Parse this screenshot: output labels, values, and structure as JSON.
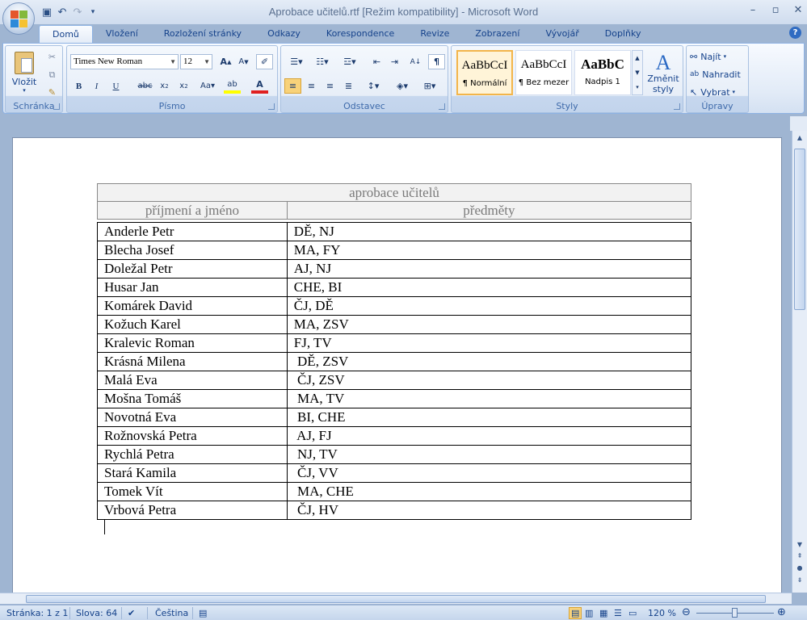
{
  "window": {
    "title": "Aprobace učitelů.rtf [Režim kompatibility] - Microsoft Word"
  },
  "ribbon": {
    "tabs": [
      "Domů",
      "Vložení",
      "Rozložení stránky",
      "Odkazy",
      "Korespondence",
      "Revize",
      "Zobrazení",
      "Vývojář",
      "Doplňky"
    ],
    "active_tab": "Domů",
    "clipboard": {
      "paste_label": "Vložit",
      "group_label": "Schránka"
    },
    "font": {
      "name": "Times New Roman",
      "size": "12",
      "group_label": "Písmo"
    },
    "paragraph": {
      "group_label": "Odstavec"
    },
    "styles": {
      "items": [
        {
          "sample": "AaBbCcI",
          "name": "¶ Normální"
        },
        {
          "sample": "AaBbCcI",
          "name": "¶ Bez mezer"
        },
        {
          "sample": "AaBbC",
          "name": "Nadpis 1"
        }
      ],
      "change_styles_line1": "Změnit",
      "change_styles_line2": "styly",
      "group_label": "Styly"
    },
    "editing": {
      "find": "Najít",
      "replace": "Nahradit",
      "select": "Vybrat",
      "group_label": "Úpravy"
    }
  },
  "document": {
    "table": {
      "caption": "aprobace učitelů",
      "headers": [
        "příjmení a jméno",
        "předměty"
      ],
      "rows": [
        [
          "Anderle Petr",
          "DĚ, NJ"
        ],
        [
          "Blecha Josef",
          "MA, FY"
        ],
        [
          "Doležal Petr",
          "AJ, NJ"
        ],
        [
          "Husar Jan",
          "CHE, BI"
        ],
        [
          "Komárek David",
          "ČJ, DĚ"
        ],
        [
          "Kožuch Karel",
          "MA, ZSV"
        ],
        [
          "Kralevic Roman",
          "FJ, TV"
        ],
        [
          "Krásná Milena",
          " DĚ, ZSV"
        ],
        [
          "Malá Eva",
          " ČJ, ZSV"
        ],
        [
          "Mošna Tomáš",
          " MA, TV"
        ],
        [
          "Novotná Eva",
          " BI, CHE"
        ],
        [
          "Rožnovská Petra",
          " AJ, FJ"
        ],
        [
          "Rychlá Petra",
          " NJ, TV"
        ],
        [
          "Stará Kamila",
          " ČJ, VV"
        ],
        [
          "Tomek Vít",
          " MA, CHE"
        ],
        [
          "Vrbová Petra",
          " ČJ, HV"
        ]
      ]
    }
  },
  "statusbar": {
    "page": "Stránka: 1 z 1",
    "words": "Slova: 64",
    "language": "Čeština",
    "zoom": "120 %"
  }
}
